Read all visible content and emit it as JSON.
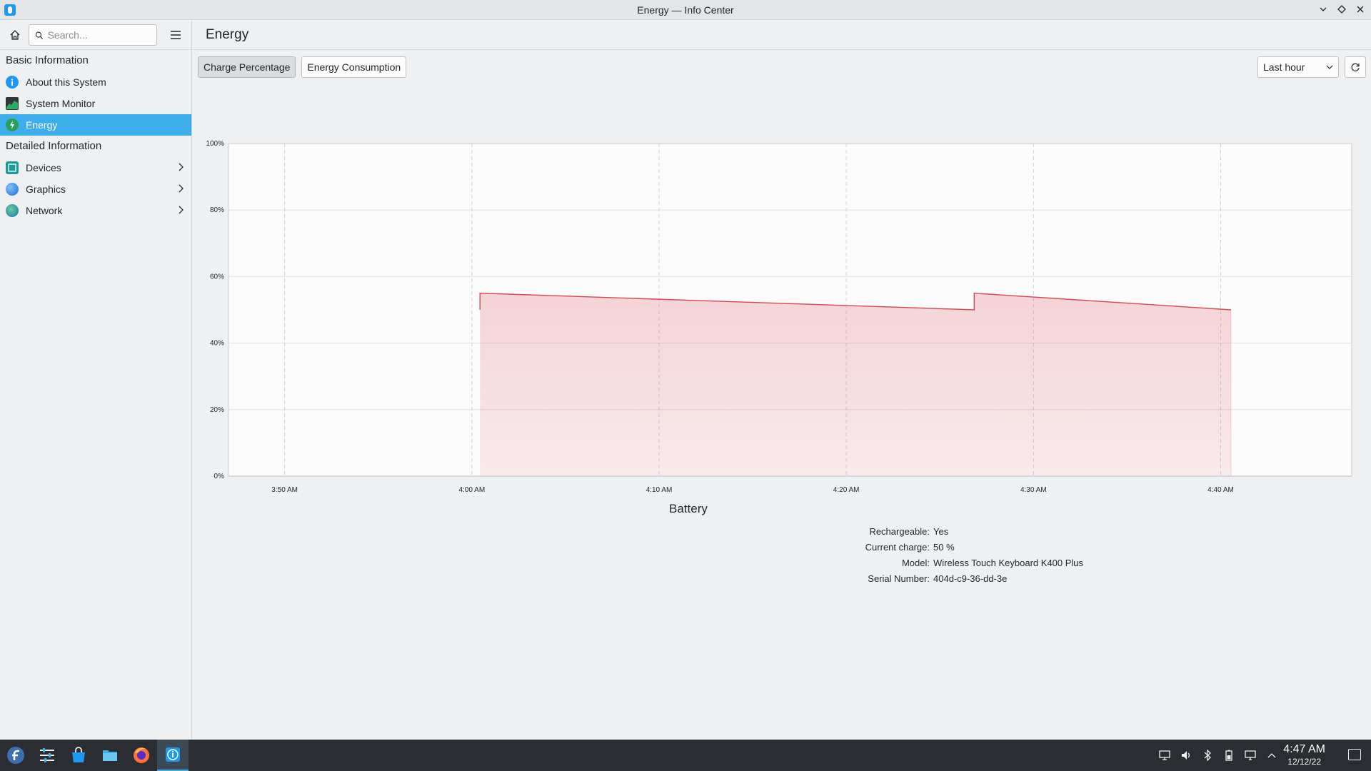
{
  "window": {
    "title": "Energy — Info Center"
  },
  "sidebar": {
    "search_placeholder": "Search...",
    "sections": [
      {
        "title": "Basic Information",
        "items": [
          {
            "label": "About this System",
            "icon": "info-icon"
          },
          {
            "label": "System Monitor",
            "icon": "system-monitor-icon"
          },
          {
            "label": "Energy",
            "icon": "energy-icon",
            "selected": true
          }
        ]
      },
      {
        "title": "Detailed Information",
        "items": [
          {
            "label": "Devices",
            "icon": "devices-icon",
            "has_children": true
          },
          {
            "label": "Graphics",
            "icon": "graphics-icon",
            "has_children": true
          },
          {
            "label": "Network",
            "icon": "network-icon",
            "has_children": true
          }
        ]
      }
    ]
  },
  "main": {
    "title": "Energy",
    "tabs": [
      {
        "label": "Charge Percentage",
        "active": true
      },
      {
        "label": "Energy Consumption",
        "active": false
      }
    ],
    "time_range": "Last hour"
  },
  "chart_data": {
    "type": "area",
    "y_tick_labels": [
      "0%",
      "20%",
      "40%",
      "60%",
      "80%",
      "100%"
    ],
    "x_tick_labels": [
      "3:50 AM",
      "4:00 AM",
      "4:10 AM",
      "4:20 AM",
      "4:30 AM",
      "4:40 AM"
    ],
    "ylim": [
      0,
      100
    ],
    "xlim_minutes_after_3_50": [
      -3,
      57
    ],
    "grid": true,
    "series": [
      {
        "color": "#da4453",
        "points": [
          {
            "t": "4:00:26 AM",
            "y": 50
          },
          {
            "t": "4:00:26 AM",
            "y": 55
          },
          {
            "t": "4:26:50 AM",
            "y": 50
          },
          {
            "t": "4:26:50 AM",
            "y": 55
          },
          {
            "t": "4:40:33 AM",
            "y": 50
          }
        ]
      }
    ]
  },
  "battery": {
    "heading": "Battery",
    "fields": [
      {
        "key": "Rechargeable:",
        "value": "Yes"
      },
      {
        "key": "Current charge:",
        "value": "50 %"
      },
      {
        "key": "Model:",
        "value": "Wireless Touch Keyboard K400 Plus"
      },
      {
        "key": "Serial Number:",
        "value": "404d-c9-36-dd-3e"
      }
    ]
  },
  "taskbar": {
    "apps": [
      "fedora-launcher-icon",
      "system-settings-icon",
      "discover-store-icon",
      "file-manager-icon",
      "firefox-icon",
      "info-center-icon"
    ],
    "tray": [
      "display-icon",
      "volume-icon",
      "bluetooth-icon",
      "battery-icon",
      "network-icon",
      "expand-tray-icon"
    ],
    "time": "4:47 AM",
    "date": "12/12/22"
  }
}
